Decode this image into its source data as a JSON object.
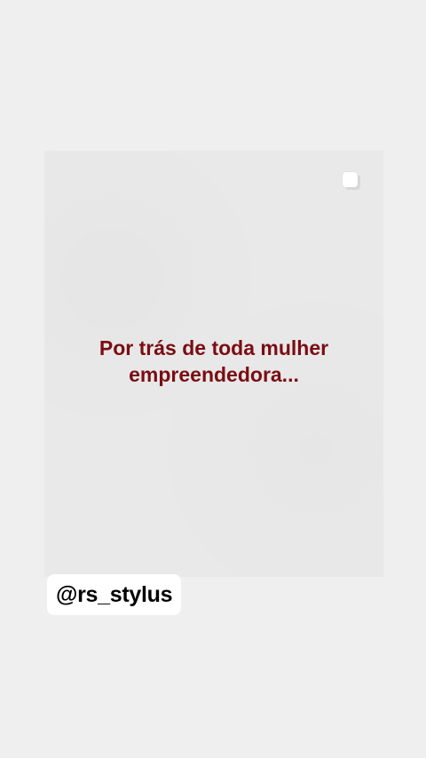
{
  "post": {
    "headline_line1": "Por trás de toda mulher",
    "headline_line2": "empreendedora...",
    "carousel_icon": "multiple-images-icon",
    "headline_color": "#7a0d13"
  },
  "sticker": {
    "username": "@rs_stylus"
  },
  "colors": {
    "background": "#efefef",
    "card": "#e9e9e9",
    "sticker_bg": "#ffffff"
  }
}
